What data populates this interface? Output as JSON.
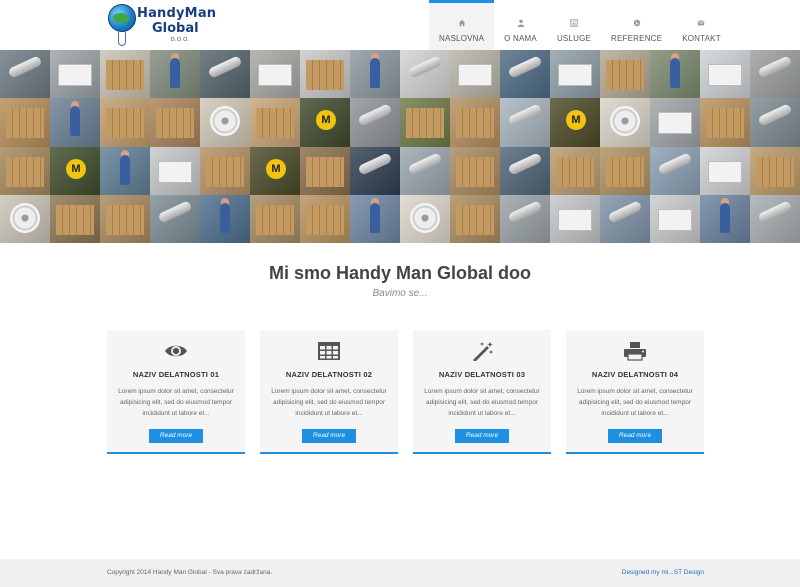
{
  "logo": {
    "line1": "HandyMan",
    "line2": "Global",
    "line3": "D.O.O."
  },
  "nav": {
    "items": [
      {
        "label": "NASLOVNA",
        "icon": "home-icon",
        "active": true
      },
      {
        "label": "O NAMA",
        "icon": "user-icon",
        "active": false
      },
      {
        "label": "USLUGE",
        "icon": "list-icon",
        "active": false
      },
      {
        "label": "REFERENCE",
        "icon": "globe-icon",
        "active": false
      },
      {
        "label": "KONTAKT",
        "icon": "envelope-icon",
        "active": false
      }
    ]
  },
  "banner": {
    "tile_kinds": [
      "pipe",
      "ac",
      "box",
      "person",
      "pipe",
      "ac",
      "box",
      "person",
      "pipe",
      "ac",
      "pipe",
      "ac",
      "box",
      "person",
      "ac",
      "pipe",
      "box",
      "person",
      "box",
      "box",
      "fan",
      "box",
      "logo-m",
      "pipe",
      "box",
      "box",
      "pipe",
      "logo-m",
      "fan",
      "ac",
      "box",
      "pipe",
      "box",
      "logo-m",
      "person",
      "ac",
      "box",
      "logo-m",
      "box",
      "pipe",
      "pipe",
      "box",
      "pipe",
      "box",
      "box",
      "pipe",
      "ac",
      "box",
      "fan",
      "box",
      "box",
      "pipe",
      "person",
      "box",
      "box",
      "person",
      "fan",
      "box",
      "pipe",
      "ac",
      "pipe",
      "ac",
      "person",
      "pipe"
    ],
    "tile_colors": [
      "#6d7a83",
      "#9aa3a8",
      "#c7c2b3",
      "#7f8c7c",
      "#55646e",
      "#a6a8a2",
      "#c9c9c9",
      "#8a97a1",
      "#d3d3d3",
      "#b7b3a5",
      "#4d6b86",
      "#8e9ea6",
      "#b5a893",
      "#7b8a6f",
      "#cfd3d6",
      "#9b9f9e",
      "#b58d5a",
      "#6b7f96",
      "#c29c6b",
      "#a8835a",
      "#cfc8b8",
      "#c8a577",
      "#3e4a2c",
      "#8f9498",
      "#6e7a45",
      "#b48e61",
      "#a7b4bf",
      "#4b4a26",
      "#d9d4c6",
      "#9fa4a8",
      "#b8905e",
      "#7d8a93",
      "#a4875b",
      "#3f4d2a",
      "#5f7f96",
      "#c5c8ca",
      "#b38f63",
      "#4a4b28",
      "#8a6e4a",
      "#2f3f52",
      "#9aa6ad",
      "#a88a5c",
      "#4f6478",
      "#b79b6d",
      "#ae9160",
      "#8aa0b4",
      "#cfd1d3",
      "#bb9a68",
      "#c9c4b6",
      "#8c7552",
      "#a8885c",
      "#7d8c95",
      "#4d6e8f",
      "#a68a62",
      "#b7925f",
      "#6d87a3",
      "#ddd8cb",
      "#a98b5e",
      "#9aa2a6",
      "#c3c6c8",
      "#7f93a8",
      "#c9cbcd",
      "#6a83a0",
      "#a7adb0"
    ]
  },
  "intro": {
    "title": "Mi smo Handy Man Global doo",
    "subtitle": "Bavimo se..."
  },
  "cards": [
    {
      "icon": "eye-icon",
      "title": "NAZIV DELATNOSTI 01",
      "text": "Lorem ipsum dolor sit amet, consectetur adipisicing elit, sed do eiusmod tempor incididunt ut labore et...",
      "button": "Read more"
    },
    {
      "icon": "table-icon",
      "title": "NAZIV DELATNOSTI 02",
      "text": "Lorem ipsum dolor sit amet, consectetur adipisicing elit, sed do eiusmod tempor incididunt ut labore et...",
      "button": "Read more"
    },
    {
      "icon": "magic-wand-icon",
      "title": "NAZIV DELATNOSTI 03",
      "text": "Lorem ipsum dolor sit amet, consectetur adipisicing elit, sed do eiusmod tempor incididunt ut labore et...",
      "button": "Read more"
    },
    {
      "icon": "printer-icon",
      "title": "NAZIV DELATNOSTI 04",
      "text": "Lorem ipsum dolor sit amet, consectetur adipisicing elit, sed do eiusmod tempor incididunt ut labore et...",
      "button": "Read more"
    }
  ],
  "footer": {
    "copyright": "Copyright 2014 Handy Man Global - Sva prava zadržana.",
    "designer": "Designed my mi...ST Design"
  },
  "colors": {
    "accent": "#1e8fe1",
    "logo": "#173e83"
  }
}
